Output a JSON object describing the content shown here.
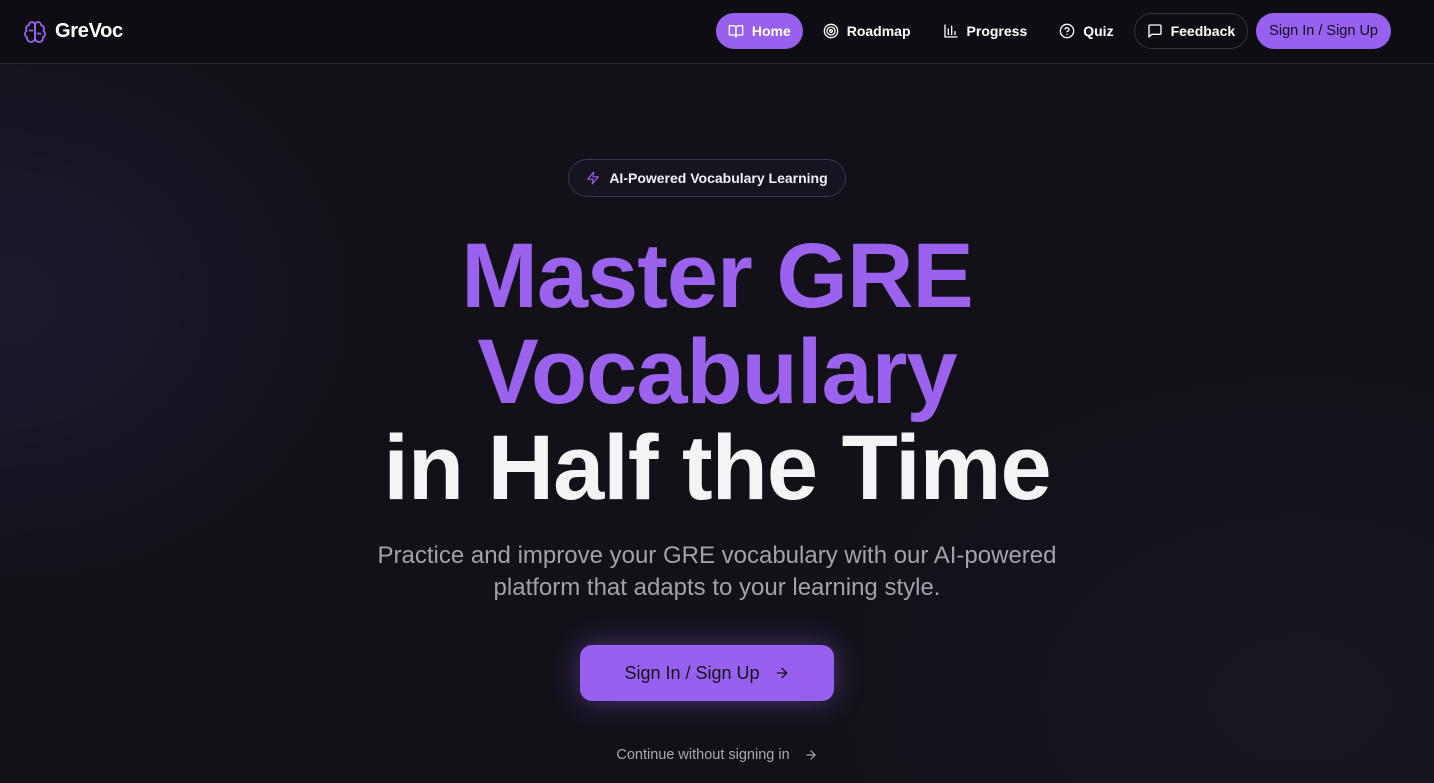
{
  "app": {
    "name": "GreVoc",
    "logo_icon": "brain-icon"
  },
  "nav": {
    "items": [
      {
        "label": "Home",
        "icon": "book-icon",
        "active": true
      },
      {
        "label": "Roadmap",
        "icon": "target-icon",
        "active": false
      },
      {
        "label": "Progress",
        "icon": "bar-chart-icon",
        "active": false
      },
      {
        "label": "Quiz",
        "icon": "help-circle-icon",
        "active": false
      },
      {
        "label": "Feedback",
        "icon": "message-square-icon",
        "active": false
      }
    ],
    "auth_label": "Sign In / Sign Up"
  },
  "hero": {
    "badge": {
      "label": "AI-Powered Vocabulary Learning",
      "icon": "lightning-icon"
    },
    "headline_line1": "Master GRE",
    "headline_line2": "Vocabulary",
    "headline_line3": "in Half the Time",
    "subtitle_line1": "Practice and improve your GRE vocabulary with our AI-powered",
    "subtitle_line2": "platform that adapts to your learning style.",
    "cta_label": "Sign In / Sign Up",
    "cta_icon": "arrow-right-icon",
    "skip_label": "Continue without signing in",
    "skip_icon": "arrow-right-icon"
  },
  "colors": {
    "accent": "#9760ee",
    "background": "#121118",
    "navbar": "#0e0d13",
    "text_muted": "#a2a1ab"
  }
}
